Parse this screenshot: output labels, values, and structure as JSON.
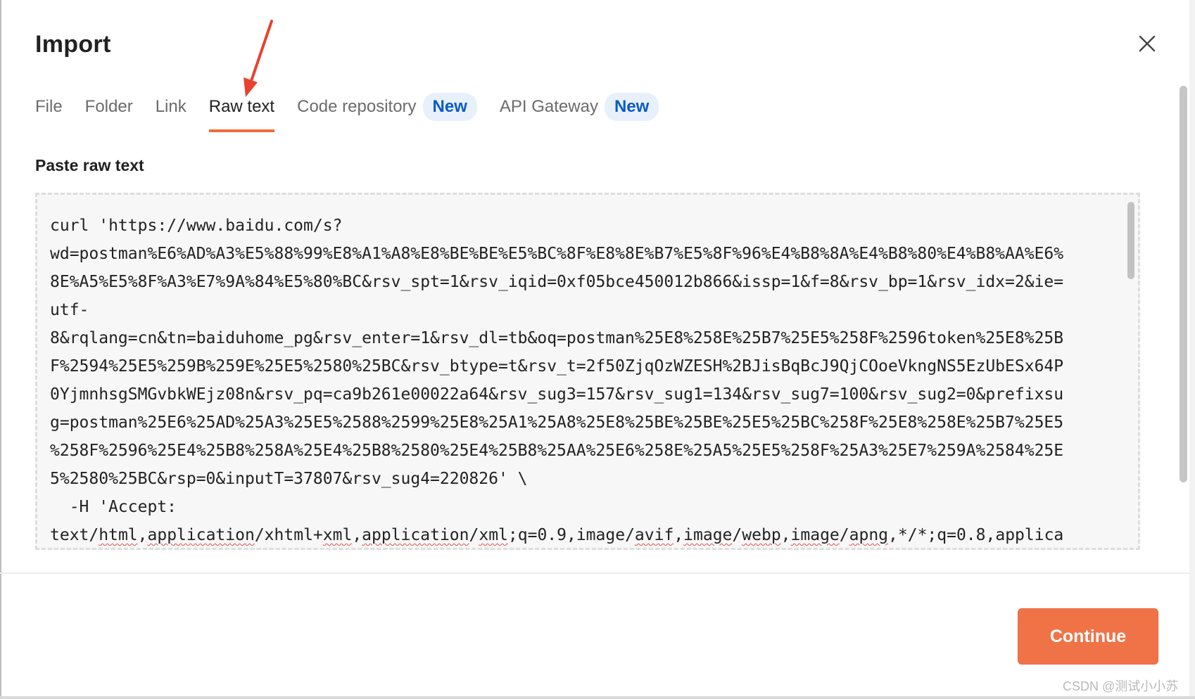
{
  "dialog": {
    "title": "Import",
    "close_icon": "close-icon"
  },
  "tabs": [
    {
      "label": "File",
      "active": false
    },
    {
      "label": "Folder",
      "active": false
    },
    {
      "label": "Link",
      "active": false
    },
    {
      "label": "Raw text",
      "active": true
    },
    {
      "label": "Code repository",
      "badge": "New",
      "active": false
    },
    {
      "label": "API Gateway",
      "badge": "New",
      "active": false
    }
  ],
  "raw_text": {
    "label": "Paste raw text",
    "lines": [
      "curl 'https://www.baidu.com/s?",
      "wd=postman%E6%AD%A3%E5%88%99%E8%A1%A8%E8%BE%BE%E5%BC%8F%E8%8E%B7%E5%8F%96%E4%B8%8A%E4%B8%80%E4%B8%AA%E6%",
      "8E%A5%E5%8F%A3%E7%9A%84%E5%80%BC&rsv_spt=1&rsv_iqid=0xf05bce450012b866&issp=1&f=8&rsv_bp=1&rsv_idx=2&ie=",
      "utf-",
      "8&rqlang=cn&tn=baiduhome_pg&rsv_enter=1&rsv_dl=tb&oq=postman%25E8%258E%25B7%25E5%258F%2596token%25E8%25B",
      "F%2594%25E5%259B%259E%25E5%2580%25BC&rsv_btype=t&rsv_t=2f50ZjqOzWZESH%2BJisBqBcJ9QjCOoeVkngNS5EzUbESx64P",
      "0YjmnhsgSMGvbkWEjz08n&rsv_pq=ca9b261e00022a64&rsv_sug3=157&rsv_sug1=134&rsv_sug7=100&rsv_sug2=0&prefixsu",
      "g=postman%25E6%25AD%25A3%25E5%2588%2599%25E8%25A1%25A8%25E8%25BE%25BE%25E5%25BC%258F%25E8%258E%25B7%25E5",
      "%258F%2596%25E4%25B8%258A%25E4%25B8%2580%25E4%25B8%25AA%25E6%258E%25A5%25E5%258F%25A3%25E7%259A%2584%25E",
      "5%2580%25BC&rsp=0&inputT=37807&rsv_sug4=220826' \\",
      "  -H 'Accept:"
    ],
    "last_line_segments": [
      "text/",
      "html",
      ",",
      "application",
      "/xhtml+",
      "xml",
      ",",
      "application",
      "/",
      "xml",
      ";q=0.9,image/",
      "avif",
      ",",
      "image",
      "/",
      "webp",
      ",",
      "image",
      "/",
      "apng",
      ",*/*;q=0.8,applica"
    ]
  },
  "footer": {
    "continue_label": "Continue"
  },
  "watermark": "CSDN @测试小小苏",
  "colors": {
    "accent": "#f07348",
    "tab_underline": "#f26b3a",
    "badge_bg": "#e8f0fb",
    "badge_text": "#0a5bc4",
    "annotation_arrow": "#e8422f"
  }
}
